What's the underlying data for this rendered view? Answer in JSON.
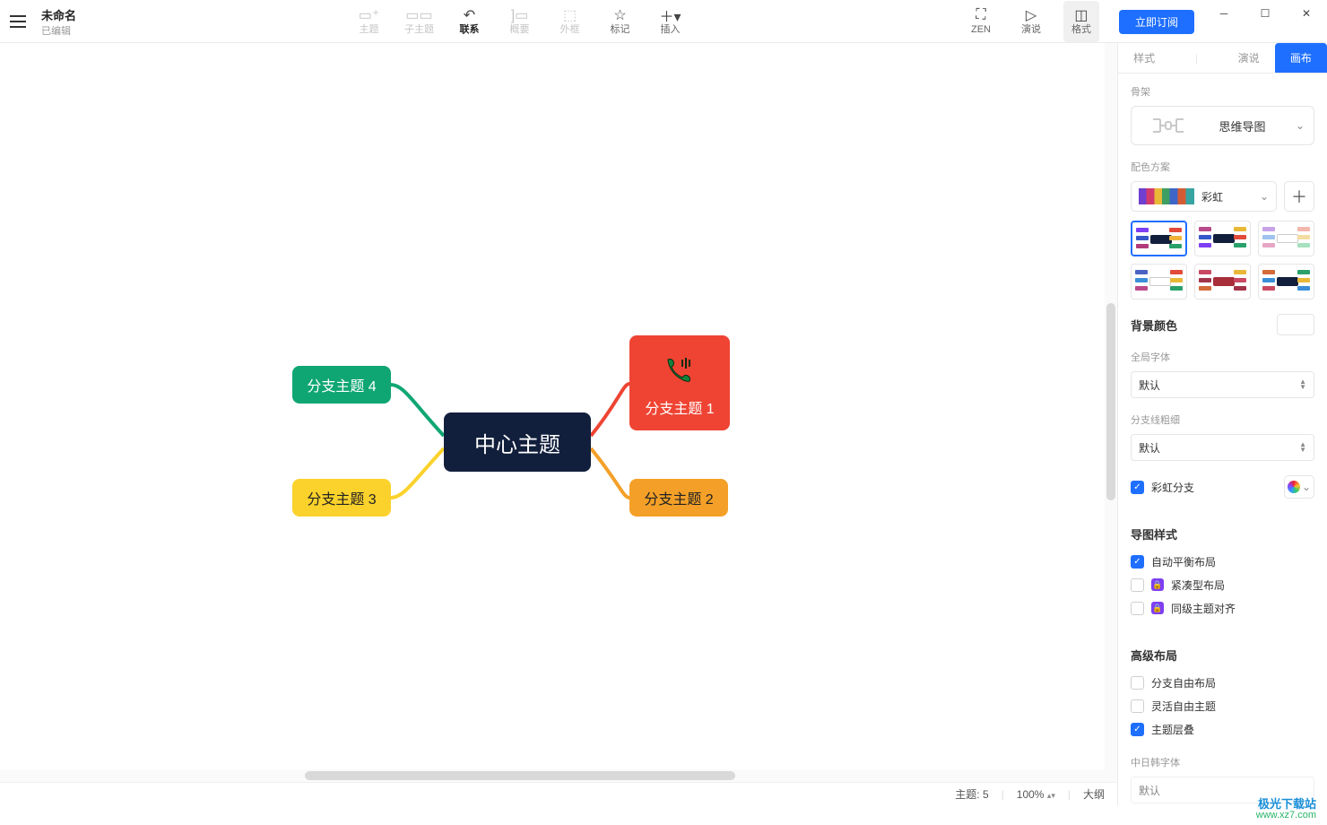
{
  "doc": {
    "title": "未命名",
    "status": "已编辑"
  },
  "toolbar": {
    "topic": "主题",
    "subtopic": "子主题",
    "relationship": "联系",
    "summary": "概要",
    "boundary": "外框",
    "marker": "标记",
    "insert": "插入",
    "zen": "ZEN",
    "present": "演说",
    "format": "格式"
  },
  "subscribe": "立即订阅",
  "mindmap": {
    "central": "中心主题",
    "b1": "分支主题 1",
    "b2": "分支主题 2",
    "b3": "分支主题 3",
    "b4": "分支主题 4"
  },
  "statusbar": {
    "topics_label": "主题:",
    "topics_count": "5",
    "zoom": "100%",
    "outline": "大纲"
  },
  "rp": {
    "tabs": {
      "style": "样式",
      "present": "演说",
      "canvas": "画布"
    },
    "skeleton_label": "骨架",
    "skeleton_value": "思维导图",
    "scheme_label": "配色方案",
    "scheme_value": "彩虹",
    "bg_label": "背景颜色",
    "global_font_label": "全局字体",
    "global_font_value": "默认",
    "branch_width_label": "分支线粗细",
    "branch_width_value": "默认",
    "rainbow_branch": "彩虹分支",
    "map_style_title": "导图样式",
    "auto_balance": "自动平衡布局",
    "compact": "紧凑型布局",
    "align_siblings": "同级主题对齐",
    "adv_title": "高级布局",
    "free_branch": "分支自由布局",
    "free_topic": "灵活自由主题",
    "overlap": "主题层叠",
    "cjk_font_label": "中日韩字体",
    "cjk_font_value": "默认"
  },
  "watermark": {
    "brand": "极光下载站",
    "url": "www.xz7.com"
  }
}
